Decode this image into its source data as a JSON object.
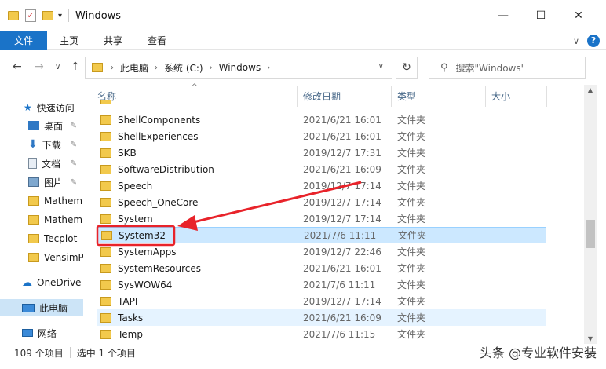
{
  "window": {
    "title": "Windows",
    "minimize": "—",
    "maximize": "☐",
    "close": "✕"
  },
  "ribbon": {
    "tabs": [
      "文件",
      "主页",
      "共享",
      "查看"
    ],
    "help": "?",
    "expand": "∨"
  },
  "address": {
    "crumbs": [
      "此电脑",
      "系统 (C:)",
      "Windows"
    ],
    "search_placeholder": "搜索\"Windows\""
  },
  "nav": {
    "quick_access": "快速访问",
    "items": [
      {
        "label": "桌面",
        "pinned": true
      },
      {
        "label": "下载",
        "pinned": true
      },
      {
        "label": "文档",
        "pinned": true
      },
      {
        "label": "图片",
        "pinned": true
      },
      {
        "label": "Mathem",
        "pinned": false
      },
      {
        "label": "Mathem",
        "pinned": false
      },
      {
        "label": "Tecplot",
        "pinned": false
      },
      {
        "label": "VensimP",
        "pinned": false
      }
    ],
    "onedrive": "OneDrive",
    "this_pc": "此电脑",
    "network": "网络"
  },
  "columns": {
    "name": "名称",
    "date": "修改日期",
    "type": "类型",
    "size": "大小"
  },
  "files": [
    {
      "name": "ShellComponents",
      "date": "2021/6/21 16:01",
      "type": "文件夹"
    },
    {
      "name": "ShellExperiences",
      "date": "2021/6/21 16:01",
      "type": "文件夹"
    },
    {
      "name": "SKB",
      "date": "2019/12/7 17:31",
      "type": "文件夹"
    },
    {
      "name": "SoftwareDistribution",
      "date": "2021/6/21 16:09",
      "type": "文件夹"
    },
    {
      "name": "Speech",
      "date": "2019/12/7 17:14",
      "type": "文件夹"
    },
    {
      "name": "Speech_OneCore",
      "date": "2019/12/7 17:14",
      "type": "文件夹"
    },
    {
      "name": "System",
      "date": "2019/12/7 17:14",
      "type": "文件夹"
    },
    {
      "name": "System32",
      "date": "2021/7/6 11:11",
      "type": "文件夹",
      "selected": true
    },
    {
      "name": "SystemApps",
      "date": "2019/12/7 22:46",
      "type": "文件夹"
    },
    {
      "name": "SystemResources",
      "date": "2021/6/21 16:01",
      "type": "文件夹"
    },
    {
      "name": "SysWOW64",
      "date": "2021/7/6 11:11",
      "type": "文件夹"
    },
    {
      "name": "TAPI",
      "date": "2019/12/7 17:14",
      "type": "文件夹"
    },
    {
      "name": "Tasks",
      "date": "2021/6/21 16:09",
      "type": "文件夹",
      "hover": true
    },
    {
      "name": "Temp",
      "date": "2021/7/6 11:15",
      "type": "文件夹"
    }
  ],
  "status": {
    "count": "109 个项目",
    "selected": "选中 1 个项目"
  },
  "watermark": "头条 @专业软件安装",
  "colors": {
    "accent": "#1a73c8",
    "selection": "#cce8ff",
    "annotation": "#e8232a"
  }
}
